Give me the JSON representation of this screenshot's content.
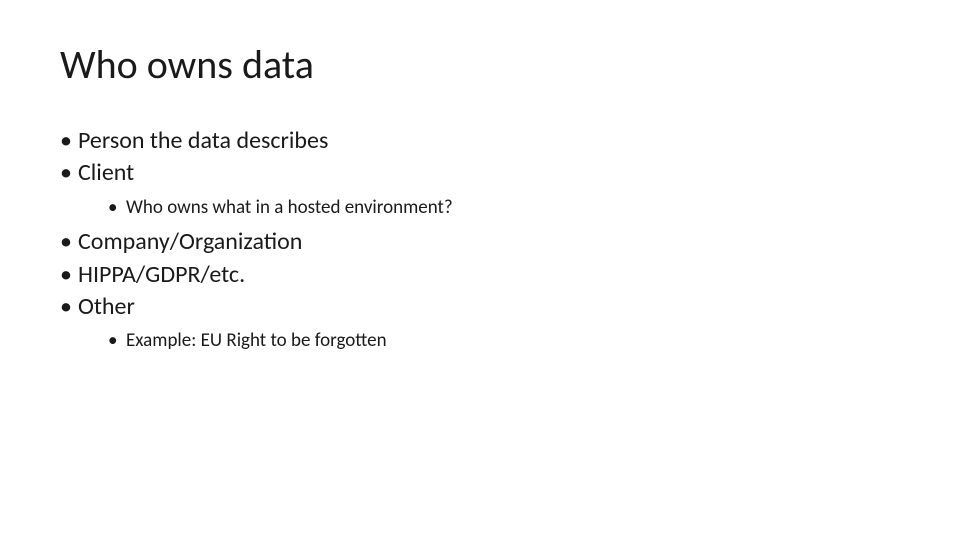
{
  "slide": {
    "title": "Who owns data",
    "bullets": [
      {
        "text": "Person the data describes",
        "sub": []
      },
      {
        "text": "Client",
        "sub": [
          "Who owns what in a hosted environment?"
        ]
      },
      {
        "text": "Company/Organization",
        "sub": []
      },
      {
        "text": "HIPPA/GDPR/etc.",
        "sub": []
      },
      {
        "text": "Other",
        "sub": [
          "Example: EU Right to be forgotten"
        ]
      }
    ]
  }
}
